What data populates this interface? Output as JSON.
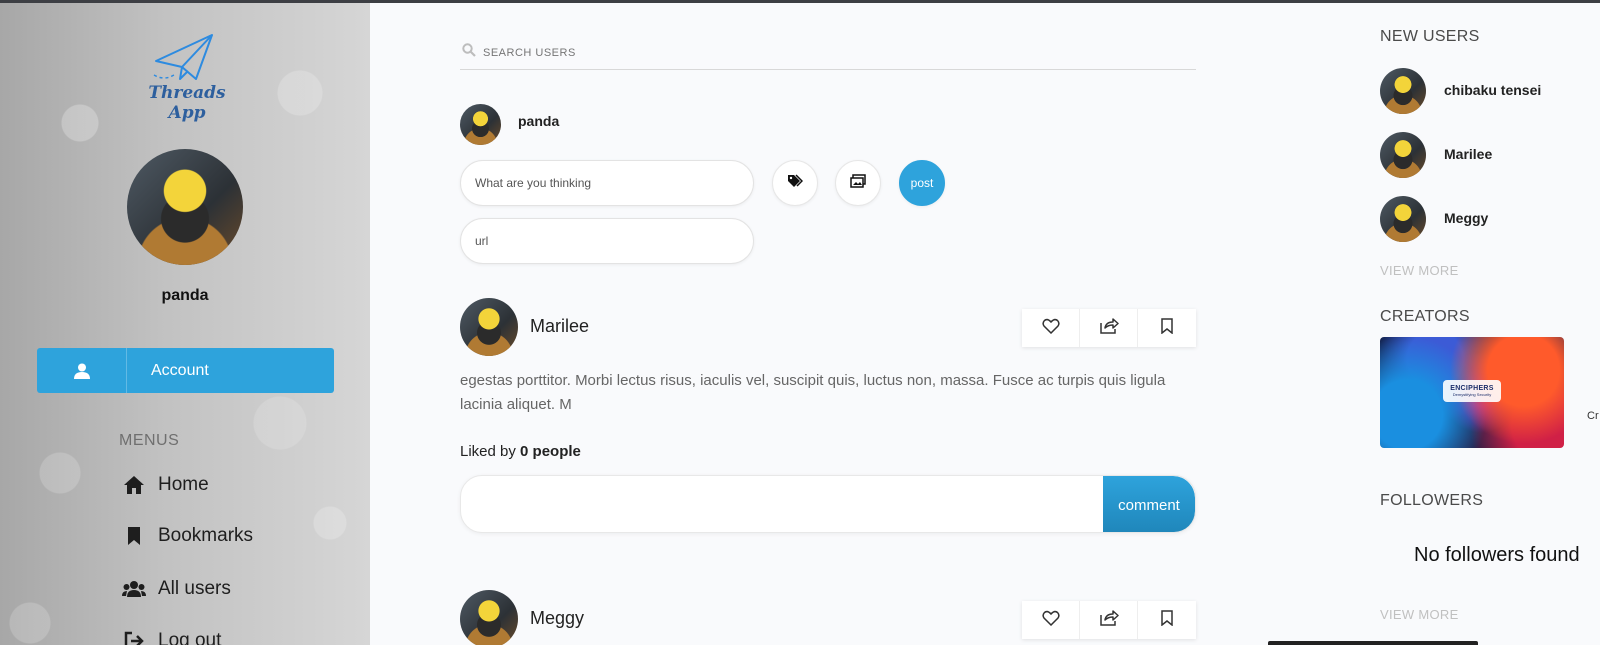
{
  "app": {
    "name": "Threads App"
  },
  "sidebar": {
    "profile_name": "panda",
    "account_label": "Account",
    "menus_heading": "MENUS",
    "menu_items": [
      {
        "label": "Home",
        "icon": "home-icon"
      },
      {
        "label": "Bookmarks",
        "icon": "bookmark-icon"
      },
      {
        "label": "All users",
        "icon": "users-icon"
      },
      {
        "label": "Log out",
        "icon": "logout-icon"
      }
    ]
  },
  "search": {
    "placeholder": "SEARCH USERS"
  },
  "composer": {
    "username": "panda",
    "thought_placeholder": "What are you thinking",
    "url_placeholder": "url",
    "post_label": "post"
  },
  "posts": [
    {
      "author": "Marilee",
      "body": "egestas porttitor. Morbi lectus risus, iaculis vel, suscipit quis, luctus non, massa. Fusce ac turpis quis ligula lacinia aliquet. M",
      "liked_prefix": "Liked by",
      "liked_count": "0 people",
      "comment_label": "comment"
    },
    {
      "author": "Meggy"
    }
  ],
  "right": {
    "new_users_heading": "NEW USERS",
    "new_users": [
      {
        "name": "chibaku tensei"
      },
      {
        "name": "Marilee"
      },
      {
        "name": "Meggy"
      }
    ],
    "view_more_label": "VIEW MORE",
    "creators_heading": "CREATORS",
    "creator_badge_title": "ENCIPHERS",
    "creator_badge_sub": "Demystifying Security",
    "creator_side_text": "Cr",
    "followers_heading": "FOLLOWERS",
    "no_followers_text": "No followers found"
  },
  "colors": {
    "accent": "#2ea3dc",
    "sidebar_bg": "#bdbdbd",
    "page_bg": "#f9fafc"
  }
}
